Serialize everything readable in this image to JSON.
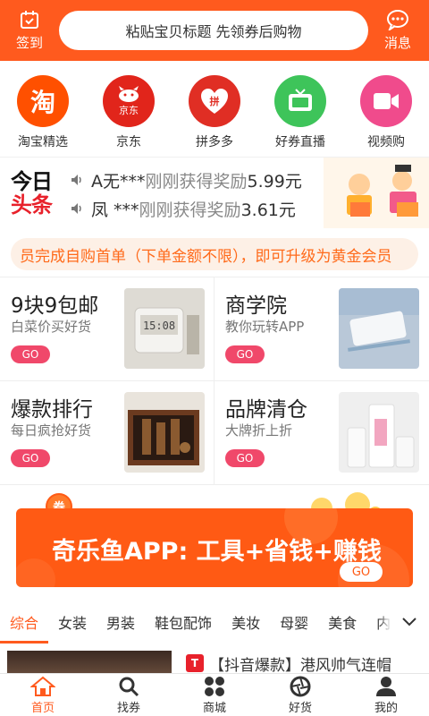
{
  "colors": {
    "brand": "#ff5a1e",
    "go_pink": "#f0486a",
    "notice_text": "#ff6a1a",
    "toutiao_red": "#e8212b"
  },
  "header": {
    "checkin_label": "签到",
    "search_placeholder": "粘贴宝贝标题 先领券后购物",
    "message_label": "消息"
  },
  "categories": [
    {
      "label": "淘宝精选",
      "icon": "taobao-logo",
      "color": "#ff5000",
      "glyph": "淘"
    },
    {
      "label": "京东",
      "icon": "jd-logo",
      "color": "#e1251b",
      "glyph": "京东"
    },
    {
      "label": "拼多多",
      "icon": "pinduoduo-logo",
      "color": "#e02e24",
      "glyph": "拼"
    },
    {
      "label": "好券直播",
      "icon": "tv-icon",
      "color": "#3ec45a"
    },
    {
      "label": "视频购",
      "icon": "video-camera-icon",
      "color": "#f04b8c"
    }
  ],
  "news": {
    "logo_line1": "今日",
    "logo_line2": "头条",
    "items": [
      {
        "name": "A无***",
        "text": "刚刚获得奖励",
        "amount": "5.99元"
      },
      {
        "name": "凤 ***",
        "text": "刚刚获得奖励",
        "amount": "3.61元"
      }
    ]
  },
  "notice": {
    "text": "员完成自购首单（下单金额不限），即可升级为黄金会员"
  },
  "features": [
    {
      "title": "9块9包邮",
      "subtitle": "白菜价买好货",
      "go": "GO",
      "image": "clock-speaker-photo"
    },
    {
      "title": "商学院",
      "subtitle": "教你玩转APP",
      "go": "GO",
      "image": "pencil-case-photo"
    },
    {
      "title": "爆款排行",
      "subtitle": "每日疯抢好货",
      "go": "GO",
      "image": "skincare-set-photo"
    },
    {
      "title": "品牌清仓",
      "subtitle": "大牌折上折",
      "go": "GO",
      "image": "cosmetics-photo"
    }
  ],
  "feature_clock_text": "15:08",
  "banner": {
    "badge": "券",
    "text": "奇乐鱼APP: 工具+省钱+赚钱",
    "go": "GO"
  },
  "tabs": {
    "items": [
      "综合",
      "女装",
      "男装",
      "鞋包配饰",
      "美妆",
      "母婴",
      "美食",
      "内衣"
    ],
    "active_index": 0
  },
  "product": {
    "badge": "T",
    "title": "【抖音爆款】港风帅气连帽"
  },
  "bottom_nav": [
    {
      "label": "首页",
      "icon": "home-icon",
      "active": true
    },
    {
      "label": "找券",
      "icon": "search-icon",
      "active": false
    },
    {
      "label": "商城",
      "icon": "grid-icon",
      "active": false
    },
    {
      "label": "好货",
      "icon": "aperture-icon",
      "active": false
    },
    {
      "label": "我的",
      "icon": "user-icon",
      "active": false
    }
  ]
}
